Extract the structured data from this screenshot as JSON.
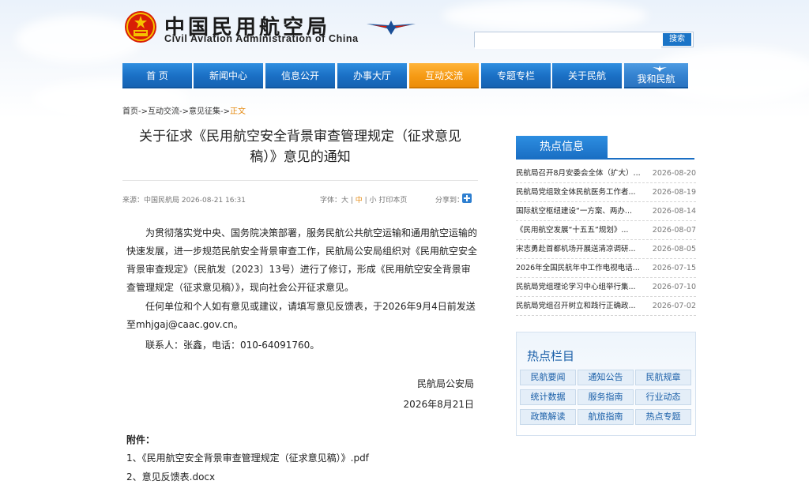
{
  "header": {
    "title_cn": "中国民用航空局",
    "title_en": "Civil Aviation Administration of China"
  },
  "search": {
    "placeholder": "",
    "button_label": "搜索"
  },
  "nav": {
    "items": [
      {
        "label": "首 页"
      },
      {
        "label": "新闻中心"
      },
      {
        "label": "信息公开"
      },
      {
        "label": "办事大厅"
      },
      {
        "label": "互动交流"
      },
      {
        "label": "专题专栏"
      },
      {
        "label": "关于民航"
      },
      {
        "label": "我和民航"
      }
    ],
    "active_index": 4
  },
  "breadcrumb": {
    "part1": "首页->",
    "part2": "互动交流->",
    "part3": "意见征集->",
    "current": "正文"
  },
  "article": {
    "title_line1": "关于征求《民用航空安全背景审查管理规定（征求意见",
    "title_line2": "稿）》意见的通知",
    "meta": {
      "source": "来源：中国民航局   2026-08-21 16:31",
      "font_prefix": "字体：大 |",
      "font_mid": " 中 ",
      "font_suffix": "| 小   打印本页",
      "share": "分享到："
    },
    "paragraph1": "为贯彻落实党中央、国务院决策部署，服务民航公共航空运输和通用航空运输的快速发展，进一步规范民航安全背景审查工作，民航局公安局组织对《民用航空安全背景审查规定》（民航发〔2023〕13号）进行了修订，形成《民用航空安全背景审查管理规定（征求意见稿）》，现向社会公开征求意见。",
    "paragraph2": "任何单位和个人如有意见或建议，请填写意见反馈表，于2026年9月4日前发送至mhjgaj@caac.gov.cn。",
    "contact": "联系人：张鑫，电话：010-64091760。",
    "signature_org": "民航局公安局",
    "signature_date": "2026年8月21日",
    "attachments_title": "附件：",
    "attachments": [
      "1、《民用航空安全背景审查管理规定（征求意见稿）》.pdf",
      "2、意见反馈表.docx"
    ]
  },
  "hot_news": {
    "header": "热点信息",
    "items": [
      {
        "title": "民航局召开8月安委会全体（扩大）...",
        "date": "2026-08-20"
      },
      {
        "title": "民航局党组致全体民航医务工作者...",
        "date": "2026-08-19"
      },
      {
        "title": "国际航空枢纽建设“一方案、两办...",
        "date": "2026-08-14"
      },
      {
        "title": "《民用航空发展“十五五”规划》...",
        "date": "2026-08-07"
      },
      {
        "title": "宋志勇赴首都机场开展送清凉调研...",
        "date": "2026-08-05"
      },
      {
        "title": "2026年全国民航年中工作电视电话...",
        "date": "2026-07-15"
      },
      {
        "title": "民航局党组理论学习中心组举行集...",
        "date": "2026-07-10"
      },
      {
        "title": "民航局党组召开树立和践行正确政...",
        "date": "2026-07-02"
      }
    ]
  },
  "hot_columns": {
    "title": "热点栏目",
    "items": [
      {
        "label": "民航要闻"
      },
      {
        "label": "通知公告"
      },
      {
        "label": "民航规章"
      },
      {
        "label": "统计数据"
      },
      {
        "label": "服务指南"
      },
      {
        "label": "行业动态"
      },
      {
        "label": "政策解读"
      },
      {
        "label": "航旅指南"
      },
      {
        "label": "热点专题"
      }
    ]
  },
  "colors": {
    "nav_blue": "#1a6fc4",
    "nav_active": "#f59a14",
    "highlight": "#e58a11",
    "link_blue": "#1a5fa8"
  }
}
